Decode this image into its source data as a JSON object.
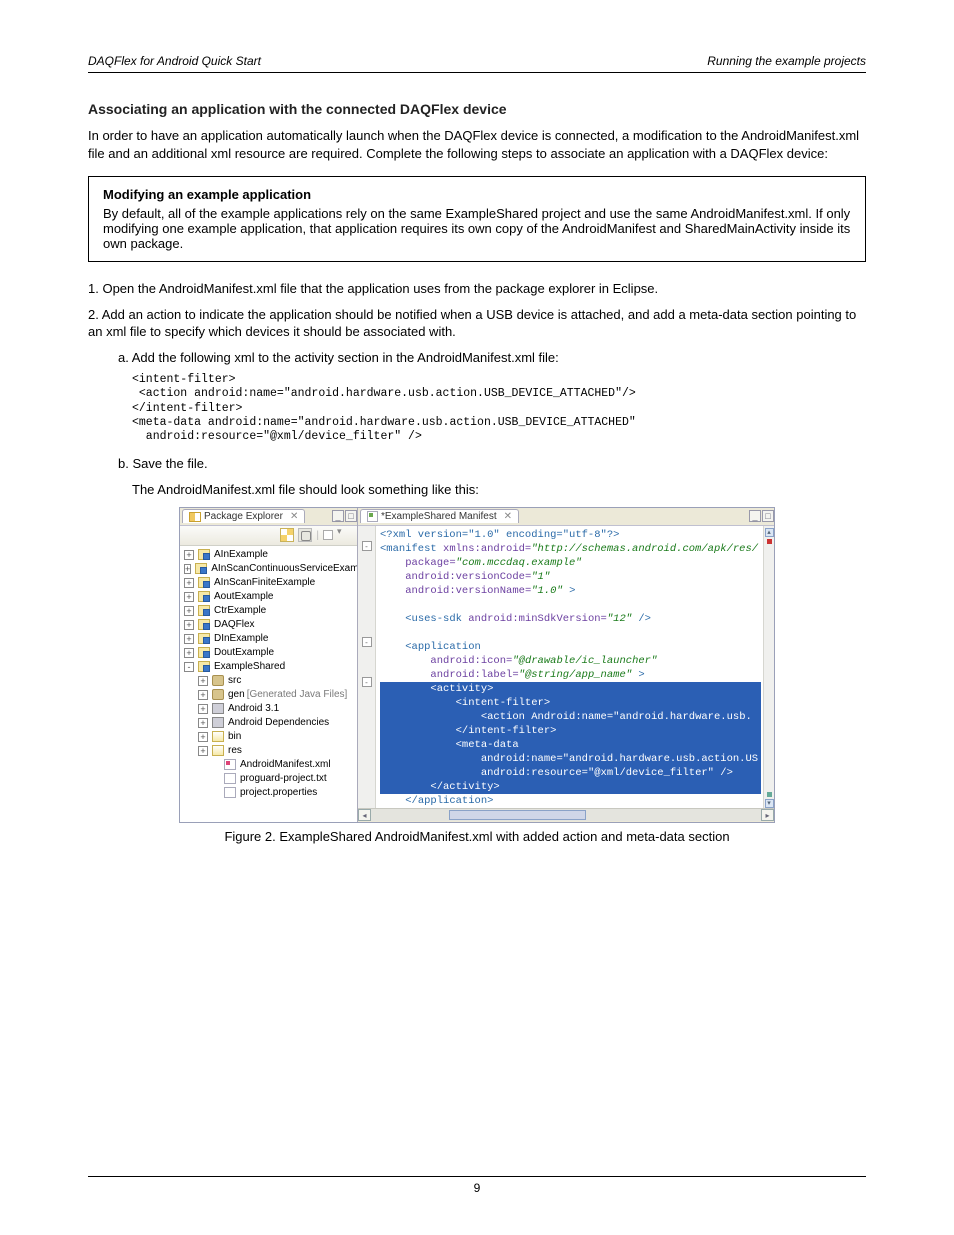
{
  "header": {
    "left": "DAQFlex for Android Quick Start",
    "right": "Running the example projects"
  },
  "section_title": "Associating an application with the connected DAQFlex device",
  "p1": "In order to have an application automatically launch when the DAQFlex device is connected, a modification to the AndroidManifest.xml file and an additional xml resource are required. Complete the following steps to associate an application with a DAQFlex device:",
  "callout": {
    "title": "Modifying an example application",
    "body": "By default, all of the example applications rely on the same ExampleShared project and use the same AndroidManifest.xml. If only modifying one example application, that application requires its own copy of the AndroidManifest and SharedMainActivity inside its own package."
  },
  "step1": "1.   Open the AndroidManifest.xml file that the application uses from the package explorer in Eclipse.",
  "step2": {
    "lead": "2.   Add an action to indicate the application should be notified when a USB device is attached, and add a meta-data section pointing to an xml file to specify which devices it should be associated with.",
    "line_a": "a.  Add the following xml to the activity section in the AndroidManifest.xml file:",
    "xml_a": "<intent-filter>\n <action android:name=\"android.hardware.usb.action.USB_DEVICE_ATTACHED\"/>\n</intent-filter>\n<meta-data android:name=\"android.hardware.usb.action.USB_DEVICE_ATTACHED\"\n  android:resource=\"@xml/device_filter\" />",
    "line_b": "b.  Save the file.",
    "after_b": "The AndroidManifest.xml file should look something like this:"
  },
  "ide": {
    "left_tab": "Package Explorer",
    "right_tab": "*ExampleShared Manifest",
    "toolbar_icons": [
      "collapse-all-icon",
      "link-editor-icon",
      "view-menu-icon",
      "dropdown-icon"
    ],
    "tree": [
      {
        "d": 0,
        "tw": "+",
        "ic": "proj",
        "label": "AInExample"
      },
      {
        "d": 0,
        "tw": "+",
        "ic": "proj",
        "label": "AInScanContinuousServiceExample"
      },
      {
        "d": 0,
        "tw": "+",
        "ic": "proj",
        "label": "AInScanFiniteExample"
      },
      {
        "d": 0,
        "tw": "+",
        "ic": "proj",
        "label": "AoutExample"
      },
      {
        "d": 0,
        "tw": "+",
        "ic": "proj",
        "label": "CtrExample"
      },
      {
        "d": 0,
        "tw": "+",
        "ic": "proj",
        "label": "DAQFlex"
      },
      {
        "d": 0,
        "tw": "+",
        "ic": "proj",
        "label": "DInExample"
      },
      {
        "d": 0,
        "tw": "+",
        "ic": "proj",
        "label": "DoutExample"
      },
      {
        "d": 0,
        "tw": "-",
        "ic": "proj",
        "label": "ExampleShared"
      },
      {
        "d": 1,
        "tw": "+",
        "ic": "pkg",
        "label": "src"
      },
      {
        "d": 1,
        "tw": "+",
        "ic": "pkg",
        "label": "gen",
        "extra": "[Generated Java Files]"
      },
      {
        "d": 1,
        "tw": "+",
        "ic": "jar",
        "label": "Android 3.1"
      },
      {
        "d": 1,
        "tw": "+",
        "ic": "jar",
        "label": "Android Dependencies"
      },
      {
        "d": 1,
        "tw": "+",
        "ic": "folder-open",
        "label": "bin"
      },
      {
        "d": 1,
        "tw": "+",
        "ic": "folder-open",
        "label": "res"
      },
      {
        "d": 2,
        "tw": " ",
        "ic": "xmlfile",
        "label": "AndroidManifest.xml"
      },
      {
        "d": 2,
        "tw": " ",
        "ic": "file",
        "label": "proguard-project.txt"
      },
      {
        "d": 2,
        "tw": " ",
        "ic": "file",
        "label": "project.properties"
      }
    ],
    "code": {
      "l1": "<?xml version=\"1.0\" encoding=\"utf-8\"?>",
      "l2a": "<manifest ",
      "l2b": "xmlns:android=",
      "l2c": "\"http://schemas.android.com/apk/res/",
      "l3a": "    package=",
      "l3b": "\"com.mccdaq.example\"",
      "l4a": "    android:versionCode=",
      "l4b": "\"1\"",
      "l5a": "    android:versionName=",
      "l5b": "\"1.0\"",
      "l5c": " >",
      "l6": "",
      "l7a": "    <uses-sdk ",
      "l7b": "android:minSdkVersion=",
      "l7c": "\"12\"",
      "l7d": " />",
      "l8": "",
      "l9": "    <application",
      "l10a": "        android:icon=",
      "l10b": "\"@drawable/ic_launcher\"",
      "l11a": "        android:label=",
      "l11b": "\"@string/app_name\"",
      "l11c": " >",
      "s1": "        <activity>",
      "s2": "            <intent-filter>",
      "s3": "                <action Android:name=\"android.hardware.usb.",
      "s4": "            </intent-filter>",
      "s5": "            <meta-data",
      "s6": "                android:name=\"android.hardware.usb.action.US",
      "s7": "                android:resource=\"@xml/device_filter\" />",
      "s8": "        </activity>",
      "l20": "    </application>"
    }
  },
  "figure_caption": "Figure 2. ExampleShared AndroidManifest.xml with added action and meta-data section",
  "footer": "9"
}
